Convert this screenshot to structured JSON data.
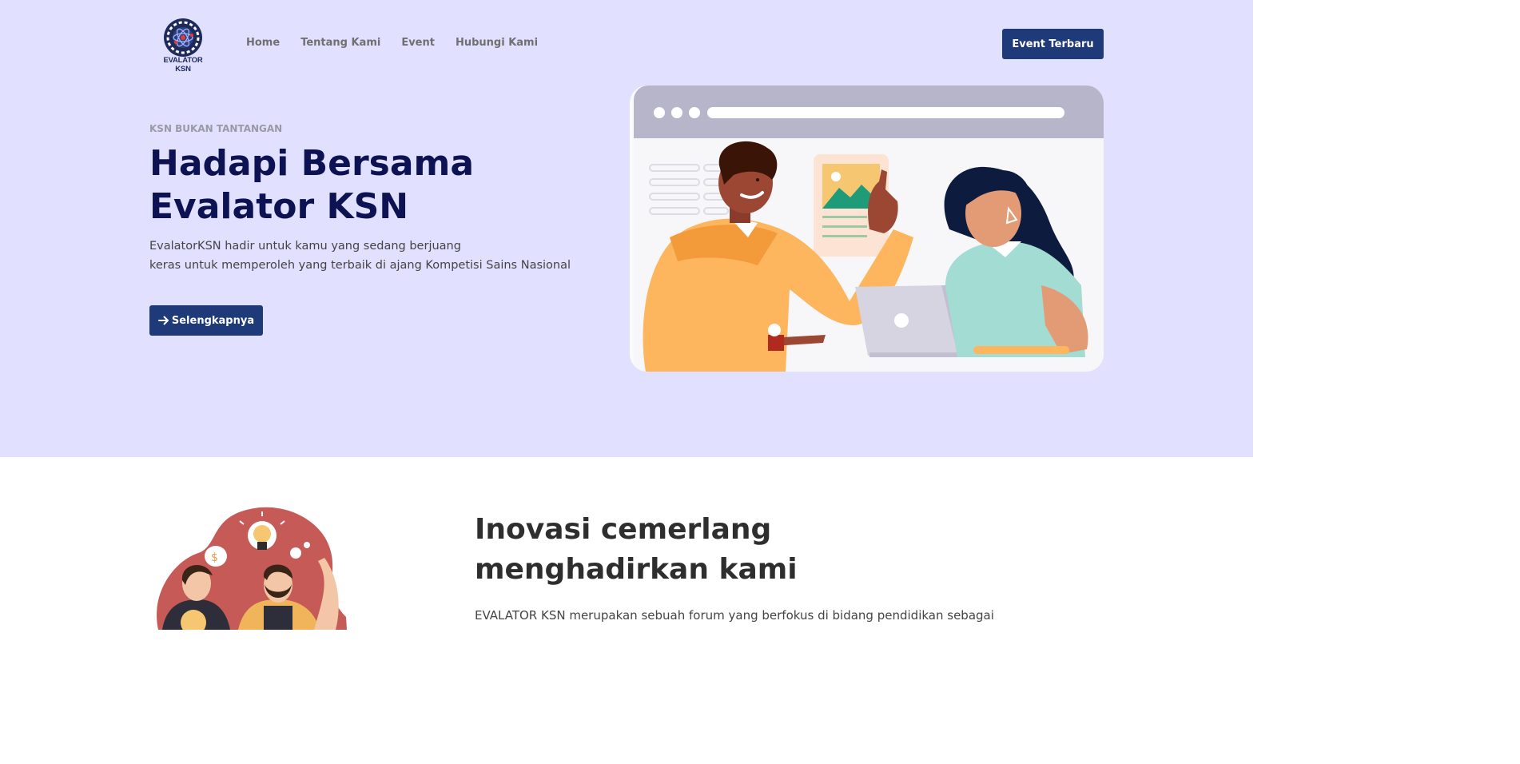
{
  "logo": {
    "text": "EVALATOR KSN"
  },
  "nav": {
    "items": [
      {
        "label": "Home"
      },
      {
        "label": "Tentang Kami"
      },
      {
        "label": "Event"
      },
      {
        "label": "Hubungi Kami"
      }
    ],
    "cta_label": "Event Terbaru"
  },
  "hero": {
    "eyebrow": "KSN BUKAN TANTANGAN",
    "title_line1": "Hadapi Bersama",
    "title_line2": "Evalator KSN",
    "desc_line1": "EvalatorKSN hadir untuk kamu yang sedang berjuang",
    "desc_line2": "keras untuk memperoleh yang terbaik di ajang Kompetisi Sains Nasional",
    "button_label": "Selengkapnya",
    "button_icon": "arrow-right-icon"
  },
  "about": {
    "title": "Inovasi cemerlang menghadirkan kami",
    "text": "EVALATOR KSN merupakan sebuah forum yang berfokus di bidang pendidikan sebagai"
  },
  "colors": {
    "hero_bg": "#e1e0ff",
    "primary": "#1e3a78",
    "title": "#0d1252"
  }
}
